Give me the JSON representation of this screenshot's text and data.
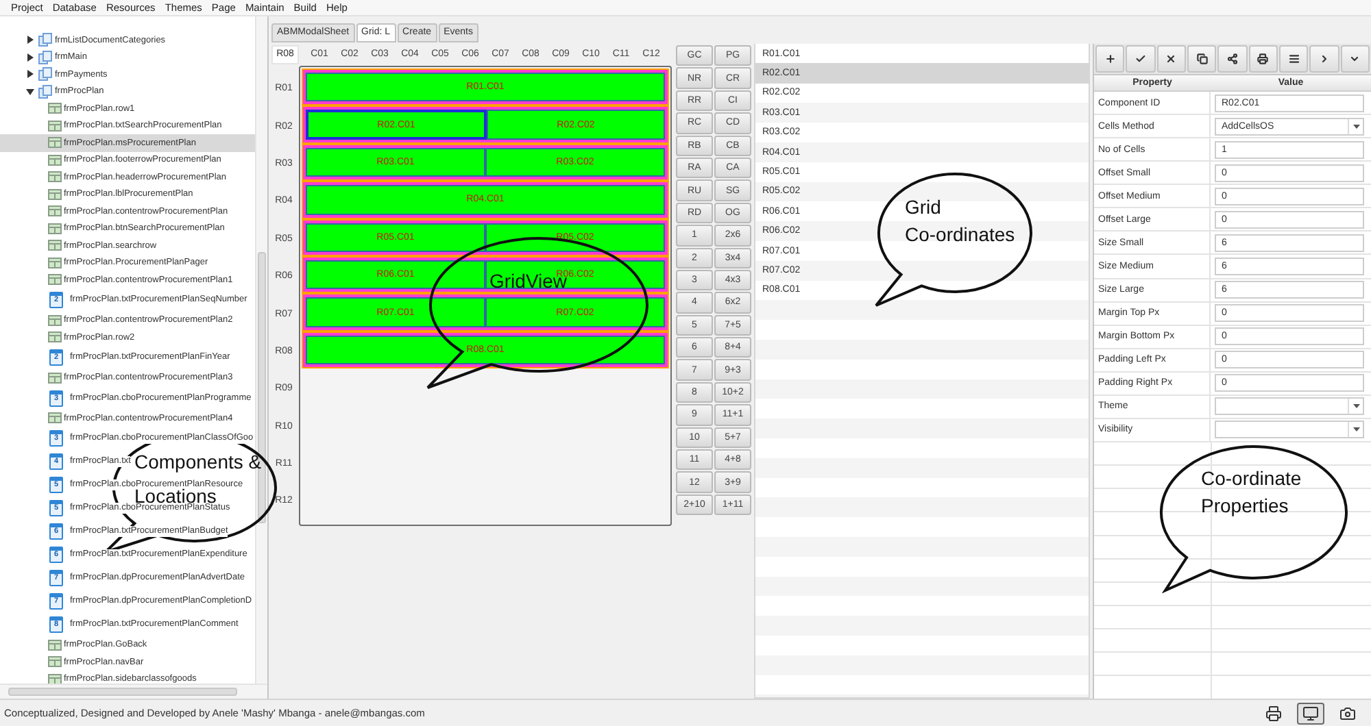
{
  "menu": [
    "Project",
    "Database",
    "Resources",
    "Themes",
    "Page",
    "Maintain",
    "Build",
    "Help"
  ],
  "tree": {
    "items": [
      {
        "label": "frmListDocumentCategories",
        "kind": "form",
        "expanded": false,
        "selected": false
      },
      {
        "label": "frmMain",
        "kind": "form",
        "expanded": false,
        "selected": false
      },
      {
        "label": "frmPayments",
        "kind": "form",
        "expanded": false,
        "selected": false
      },
      {
        "label": "frmProcPlan",
        "kind": "form",
        "expanded": true,
        "selected": false,
        "children": [
          {
            "label": "frmProcPlan.row1",
            "kind": "grid",
            "selected": false
          },
          {
            "label": "frmProcPlan.txtSearchProcurementPlan",
            "kind": "grid",
            "selected": false
          },
          {
            "label": "frmProcPlan.msProcurementPlan",
            "kind": "grid",
            "selected": true
          },
          {
            "label": "frmProcPlan.footerrowProcurementPlan",
            "kind": "grid",
            "selected": false
          },
          {
            "label": "frmProcPlan.headerrowProcurementPlan",
            "kind": "grid",
            "selected": false
          },
          {
            "label": "frmProcPlan.lblProcurementPlan",
            "kind": "grid",
            "selected": false
          },
          {
            "label": "frmProcPlan.contentrowProcurementPlan",
            "kind": "grid",
            "selected": false
          },
          {
            "label": "frmProcPlan.btnSearchProcurementPlan",
            "kind": "grid",
            "selected": false
          },
          {
            "label": "frmProcPlan.searchrow",
            "kind": "grid",
            "selected": false
          },
          {
            "label": "frmProcPlan.ProcurementPlanPager",
            "kind": "grid",
            "selected": false
          },
          {
            "label": "frmProcPlan.contentrowProcurementPlan1",
            "kind": "grid",
            "selected": false
          },
          {
            "label": "frmProcPlan.txtProcurementPlanSeqNumber",
            "kind": "calendar",
            "number": "2",
            "selected": false
          },
          {
            "label": "frmProcPlan.contentrowProcurementPlan2",
            "kind": "grid",
            "selected": false
          },
          {
            "label": "frmProcPlan.row2",
            "kind": "grid",
            "selected": false
          },
          {
            "label": "frmProcPlan.txtProcurementPlanFinYear",
            "kind": "calendar",
            "number": "2",
            "selected": false
          },
          {
            "label": "frmProcPlan.contentrowProcurementPlan3",
            "kind": "grid",
            "selected": false
          },
          {
            "label": "frmProcPlan.cboProcurementPlanProgramme",
            "kind": "calendar",
            "number": "3",
            "selected": false
          },
          {
            "label": "frmProcPlan.contentrowProcurementPlan4",
            "kind": "grid",
            "selected": false
          },
          {
            "label": "frmProcPlan.cboProcurementPlanClassOfGoo",
            "kind": "calendar",
            "number": "3",
            "selected": false
          },
          {
            "label": "frmProcPlan.txt",
            "kind": "calendar",
            "number": "4",
            "selected": false
          },
          {
            "label": "frmProcPlan.cboProcurementPlanResource",
            "kind": "calendar",
            "number": "5",
            "selected": false
          },
          {
            "label": "frmProcPlan.cboProcurementPlanStatus",
            "kind": "calendar",
            "number": "5",
            "selected": false
          },
          {
            "label": "frmProcPlan.txtProcurementPlanBudget",
            "kind": "calendar",
            "number": "6",
            "selected": false
          },
          {
            "label": "frmProcPlan.txtProcurementPlanExpenditure",
            "kind": "calendar",
            "number": "6",
            "selected": false
          },
          {
            "label": "frmProcPlan.dpProcurementPlanAdvertDate",
            "kind": "calendar",
            "number": "7",
            "selected": false
          },
          {
            "label": "frmProcPlan.dpProcurementPlanCompletionD",
            "kind": "calendar",
            "number": "7",
            "selected": false
          },
          {
            "label": "frmProcPlan.txtProcurementPlanComment",
            "kind": "calendar",
            "number": "8",
            "selected": false
          },
          {
            "label": "frmProcPlan.GoBack",
            "kind": "grid",
            "selected": false
          },
          {
            "label": "frmProcPlan.navBar",
            "kind": "grid",
            "selected": false
          },
          {
            "label": "frmProcPlan.sidebarclassofgoods",
            "kind": "grid",
            "selected": false
          }
        ]
      }
    ]
  },
  "tabs": [
    {
      "label": "ABMModalSheet",
      "selected": false
    },
    {
      "label": "Grid: L",
      "selected": true
    },
    {
      "label": "Create",
      "selected": false
    },
    {
      "label": "Events",
      "selected": false
    }
  ],
  "grid_editor": {
    "current_row": "R08",
    "columns": [
      "C01",
      "C02",
      "C03",
      "C04",
      "C05",
      "C06",
      "C07",
      "C08",
      "C09",
      "C10",
      "C11",
      "C12"
    ],
    "rows": [
      {
        "label": "R01",
        "cells": [
          {
            "label": "R01.C01",
            "selected": false
          }
        ]
      },
      {
        "label": "R02",
        "cells": [
          {
            "label": "R02.C01",
            "selected": true
          },
          {
            "label": "R02.C02",
            "selected": false
          }
        ]
      },
      {
        "label": "R03",
        "cells": [
          {
            "label": "R03.C01",
            "selected": false
          },
          {
            "label": "R03.C02",
            "selected": false
          }
        ]
      },
      {
        "label": "R04",
        "cells": [
          {
            "label": "R04.C01",
            "selected": false
          }
        ]
      },
      {
        "label": "R05",
        "cells": [
          {
            "label": "R05.C01",
            "selected": false
          },
          {
            "label": "R05.C02",
            "selected": false
          }
        ]
      },
      {
        "label": "R06",
        "cells": [
          {
            "label": "R06.C01",
            "selected": false
          },
          {
            "label": "R06.C02",
            "selected": false
          }
        ]
      },
      {
        "label": "R07",
        "cells": [
          {
            "label": "R07.C01",
            "selected": false
          },
          {
            "label": "R07.C02",
            "selected": false
          }
        ]
      },
      {
        "label": "R08",
        "cells": [
          {
            "label": "R08.C01",
            "selected": false
          }
        ]
      },
      {
        "label": "R09"
      },
      {
        "label": "R10"
      },
      {
        "label": "R11"
      },
      {
        "label": "R12"
      }
    ]
  },
  "command_buttons": [
    "GC",
    "PG",
    "NR",
    "CR",
    "RR",
    "CI",
    "RC",
    "CD",
    "RB",
    "CB",
    "RA",
    "CA",
    "RU",
    "SG",
    "RD",
    "OG",
    "1",
    "2x6",
    "2",
    "3x4",
    "3",
    "4x3",
    "4",
    "6x2",
    "5",
    "7+5",
    "6",
    "8+4",
    "7",
    "9+3",
    "8",
    "10+2",
    "9",
    "11+1",
    "10",
    "5+7",
    "11",
    "4+8",
    "12",
    "3+9",
    "2+10",
    "1+11"
  ],
  "coordinates": [
    {
      "label": "R01.C01",
      "selected": false
    },
    {
      "label": "R02.C01",
      "selected": true
    },
    {
      "label": "R02.C02",
      "selected": false
    },
    {
      "label": "R03.C01",
      "selected": false
    },
    {
      "label": "R03.C02",
      "selected": false
    },
    {
      "label": "R04.C01",
      "selected": false
    },
    {
      "label": "R05.C01",
      "selected": false
    },
    {
      "label": "R05.C02",
      "selected": false
    },
    {
      "label": "R06.C01",
      "selected": false
    },
    {
      "label": "R06.C02",
      "selected": false
    },
    {
      "label": "R07.C01",
      "selected": false
    },
    {
      "label": "R07.C02",
      "selected": false
    },
    {
      "label": "R08.C01",
      "selected": false
    }
  ],
  "properties": {
    "toolbar": [
      {
        "kind": "add"
      },
      {
        "kind": "confirm"
      },
      {
        "kind": "delete"
      },
      {
        "kind": "copy"
      },
      {
        "kind": "share"
      },
      {
        "kind": "print"
      },
      {
        "kind": "list"
      },
      {
        "kind": "next"
      },
      {
        "kind": "expand"
      }
    ],
    "columns": [
      "Property",
      "Value"
    ],
    "rows": [
      {
        "label": "Component ID",
        "kind": "text",
        "value": "R02.C01"
      },
      {
        "label": "Cells Method",
        "kind": "select",
        "value": "AddCellsOS"
      },
      {
        "label": "No of Cells",
        "kind": "text",
        "value": "1"
      },
      {
        "label": "Offset Small",
        "kind": "text",
        "value": "0"
      },
      {
        "label": "Offset Medium",
        "kind": "text",
        "value": "0"
      },
      {
        "label": "Offset Large",
        "kind": "text",
        "value": "0"
      },
      {
        "label": "Size Small",
        "kind": "text",
        "value": "6"
      },
      {
        "label": "Size Medium",
        "kind": "text",
        "value": "6"
      },
      {
        "label": "Size Large",
        "kind": "text",
        "value": "6"
      },
      {
        "label": "Margin Top Px",
        "kind": "text",
        "value": "0"
      },
      {
        "label": "Margin Bottom Px",
        "kind": "text",
        "value": "0"
      },
      {
        "label": "Padding Left Px",
        "kind": "text",
        "value": "0"
      },
      {
        "label": "Padding Right Px",
        "kind": "text",
        "value": "0"
      },
      {
        "label": "Theme",
        "kind": "select"
      },
      {
        "label": "Visibility",
        "kind": "select"
      }
    ]
  },
  "annotations": [
    {
      "lines": [
        "Components &",
        "Locations"
      ]
    },
    {
      "lines": [
        "GridView"
      ]
    },
    {
      "lines": [
        "Grid",
        "Co-ordinates"
      ]
    },
    {
      "lines": [
        "Co-ordinate",
        "Properties"
      ]
    }
  ],
  "status_bar": {
    "text": "Conceptualized, Designed and Developed by Anele 'Mashy' Mbanga - anele@mbangas.com",
    "buttons": [
      {
        "kind": "print",
        "selected": false
      },
      {
        "kind": "display",
        "selected": true
      },
      {
        "kind": "camera",
        "selected": false
      }
    ]
  }
}
